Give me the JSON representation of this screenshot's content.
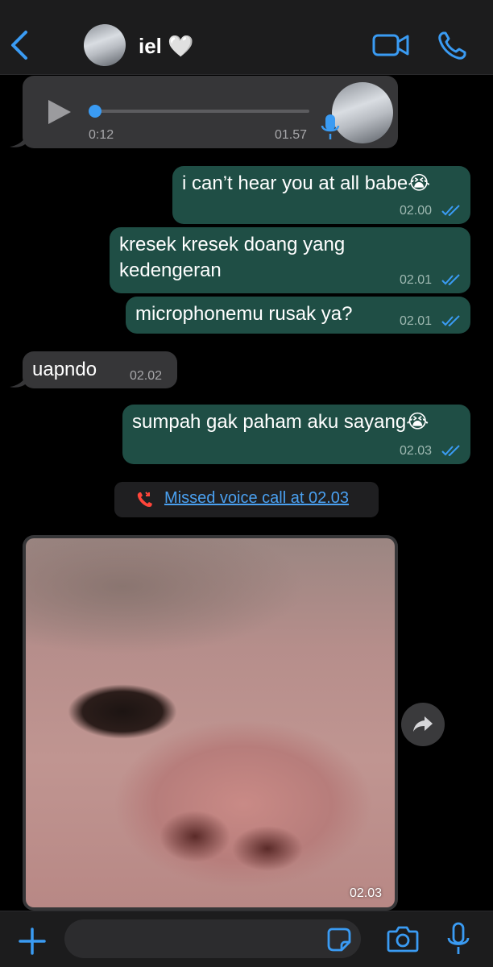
{
  "header": {
    "contact_name": "iel 🤍",
    "back_icon": "chevron-left-icon",
    "video_icon": "video-camera-icon",
    "phone_icon": "phone-icon",
    "accent_color": "#3a9bf3"
  },
  "voice_note": {
    "elapsed": "0:12",
    "timestamp": "01.57",
    "progress": 0.0
  },
  "messages": [
    {
      "text": "i can’t hear you at all babe😭",
      "time": "02.00",
      "direction": "out",
      "read": true
    },
    {
      "text": "kresek kresek doang yang kedengeran",
      "time": "02.01",
      "direction": "out",
      "read": true
    },
    {
      "text": "microphonemu rusak ya?",
      "time": "02.01",
      "direction": "out",
      "read": true
    },
    {
      "text": "uapndo",
      "time": "02.02",
      "direction": "in"
    },
    {
      "text": "sumpah gak paham aku sayang😭",
      "time": "02.03",
      "direction": "out",
      "read": true
    }
  ],
  "missed_call": {
    "text": "Missed voice call at 02.03",
    "icon": "missed-call-icon"
  },
  "photo": {
    "time": "02.03",
    "forward_icon": "forward-icon"
  },
  "input_bar": {
    "plus_icon": "plus-icon",
    "sticker_icon": "sticker-icon",
    "camera_icon": "camera-icon",
    "mic_icon": "microphone-icon"
  }
}
